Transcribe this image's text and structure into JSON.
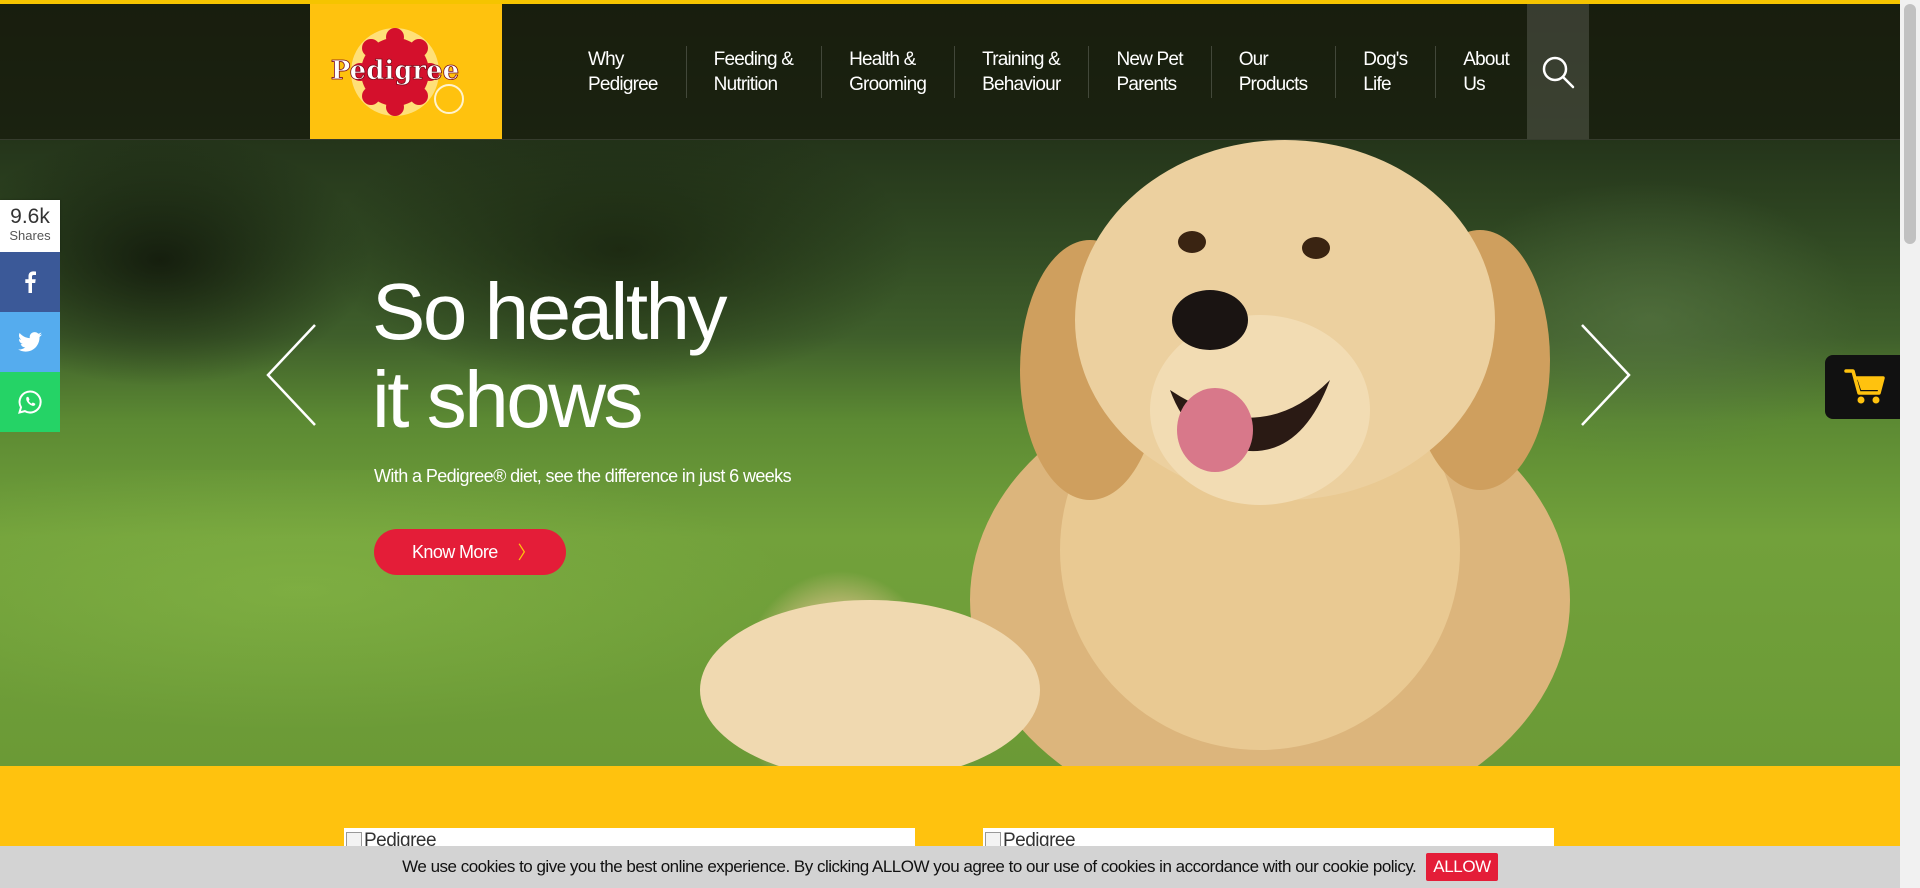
{
  "header": {
    "logo_text": "Pedigree",
    "nav": [
      {
        "label": "Why\nPedigree"
      },
      {
        "label": "Feeding &\nNutrition"
      },
      {
        "label": "Health &\nGrooming"
      },
      {
        "label": "Training &\nBehaviour"
      },
      {
        "label": "New Pet\nParents"
      },
      {
        "label": "Our\nProducts"
      },
      {
        "label": "Dog's\nLife"
      },
      {
        "label": "About\nUs"
      }
    ],
    "search_icon": "search-icon"
  },
  "hero": {
    "headline_line1": "So healthy",
    "headline_line2": "it shows",
    "subline": "With a  Pedigree® diet, see the difference in just 6 weeks",
    "cta_label": "Know More",
    "cta_chevron": "〉"
  },
  "share": {
    "count": "9.6k",
    "count_label": "Shares",
    "buttons": [
      "facebook-icon",
      "twitter-icon",
      "whatsapp-icon"
    ]
  },
  "cart_icon": "cart-icon",
  "cards": [
    {
      "alt": "Pedigree"
    },
    {
      "alt": "Pedigree"
    }
  ],
  "cookie": {
    "message": "We use cookies to give you the best online experience. By clicking ALLOW you agree to our use of cookies in accordance with our cookie policy.",
    "allow_label": "ALLOW"
  },
  "colors": {
    "brand_yellow": "#ffc20e",
    "brand_red": "#e41d38",
    "facebook": "#3b5998",
    "twitter": "#55acee",
    "whatsapp": "#25d366"
  }
}
